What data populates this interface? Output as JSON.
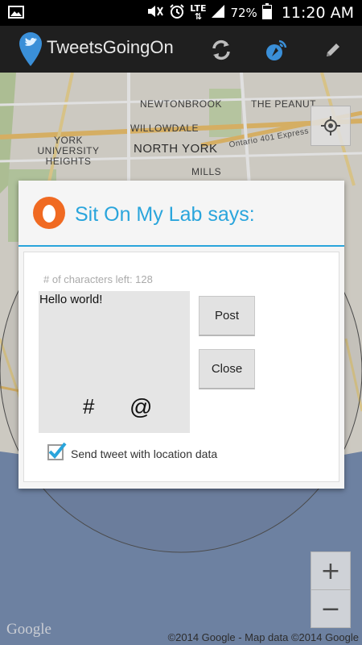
{
  "status_bar": {
    "network": "LTE",
    "battery_percent": "72%",
    "time": "11:20 AM"
  },
  "action_bar": {
    "title": "TweetsGoingOn",
    "icons": [
      "twitter-location-icon",
      "refresh-icon",
      "location-broadcast-icon",
      "pencil-icon"
    ]
  },
  "map": {
    "labels": [
      "NEWTONBROOK",
      "THE PEANUT",
      "WILLOWDALE",
      "NORTH YORK",
      "YORK UNIVERSITY HEIGHTS",
      "MILLS",
      "Ontario 401 Express"
    ],
    "zoom_in": "+",
    "zoom_out": "−",
    "google": "Google",
    "attribution": "©2014 Google - Map data ©2014 Google"
  },
  "dialog": {
    "title": "Sit On My Lab says:",
    "chars_left_label": "# of characters left: 128",
    "tweet_text": "Hello world!",
    "hashtag_symbol": "#",
    "mention_symbol": "@",
    "post_label": "Post",
    "close_label": "Close",
    "location_checkbox_label": "Send tweet with location data",
    "location_checkbox_checked": true,
    "accent_color": "#2aa5dc",
    "logo_color": "#f06a22"
  }
}
